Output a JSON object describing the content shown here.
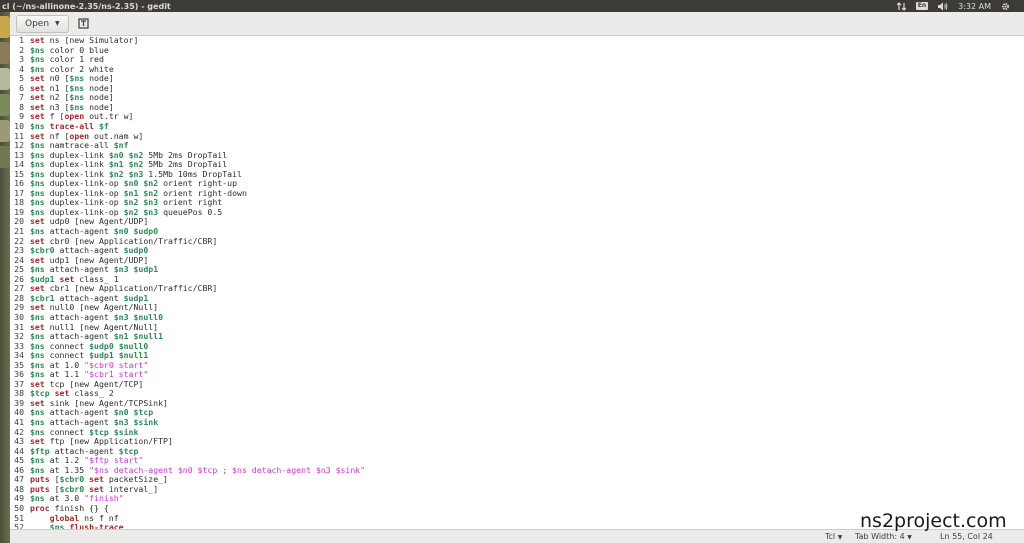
{
  "window": {
    "title": "cl (~/ns-allinone-2.35/ns-2.35) - gedit"
  },
  "tray": {
    "language": "En",
    "time": "3:32 AM"
  },
  "toolbar": {
    "open_label": "Open"
  },
  "statusbar": {
    "language": "Tcl",
    "tab_width": "Tab Width: 4",
    "position": "Ln 55, Col 24"
  },
  "watermark": "ns2project.com",
  "code_lines": [
    [
      [
        "kw",
        "set"
      ],
      [
        "t",
        " ns [new Simulator]"
      ]
    ],
    [
      [
        "var",
        "$ns"
      ],
      [
        "t",
        " color 0 blue"
      ]
    ],
    [
      [
        "var",
        "$ns"
      ],
      [
        "t",
        " color 1 red"
      ]
    ],
    [
      [
        "var",
        "$ns"
      ],
      [
        "t",
        " color 2 white"
      ]
    ],
    [
      [
        "kw",
        "set"
      ],
      [
        "t",
        " n0 ["
      ],
      [
        "var",
        "$ns"
      ],
      [
        "t",
        " node]"
      ]
    ],
    [
      [
        "kw",
        "set"
      ],
      [
        "t",
        " n1 ["
      ],
      [
        "var",
        "$ns"
      ],
      [
        "t",
        " node]"
      ]
    ],
    [
      [
        "kw",
        "set"
      ],
      [
        "t",
        " n2 ["
      ],
      [
        "var",
        "$ns"
      ],
      [
        "t",
        " node]"
      ]
    ],
    [
      [
        "kw",
        "set"
      ],
      [
        "t",
        " n3 ["
      ],
      [
        "var",
        "$ns"
      ],
      [
        "t",
        " node]"
      ]
    ],
    [
      [
        "kw",
        "set"
      ],
      [
        "t",
        " f ["
      ],
      [
        "kw",
        "open"
      ],
      [
        "t",
        " out.tr w]"
      ]
    ],
    [
      [
        "var",
        "$ns"
      ],
      [
        "t",
        " "
      ],
      [
        "kw",
        "trace-all"
      ],
      [
        "t",
        " "
      ],
      [
        "var",
        "$f"
      ]
    ],
    [
      [
        "kw",
        "set"
      ],
      [
        "t",
        " nf ["
      ],
      [
        "kw",
        "open"
      ],
      [
        "t",
        " out.nam w]"
      ]
    ],
    [
      [
        "var",
        "$ns"
      ],
      [
        "t",
        " namtrace-all "
      ],
      [
        "var",
        "$nf"
      ]
    ],
    [
      [
        "var",
        "$ns"
      ],
      [
        "t",
        " duplex-link "
      ],
      [
        "var",
        "$n0"
      ],
      [
        "t",
        " "
      ],
      [
        "var",
        "$n2"
      ],
      [
        "t",
        " 5Mb 2ms DropTail"
      ]
    ],
    [
      [
        "var",
        "$ns"
      ],
      [
        "t",
        " duplex-link "
      ],
      [
        "var",
        "$n1"
      ],
      [
        "t",
        " "
      ],
      [
        "var",
        "$n2"
      ],
      [
        "t",
        " 5Mb 2ms DropTail"
      ]
    ],
    [
      [
        "var",
        "$ns"
      ],
      [
        "t",
        " duplex-link "
      ],
      [
        "var",
        "$n2"
      ],
      [
        "t",
        " "
      ],
      [
        "var",
        "$n3"
      ],
      [
        "t",
        " 1.5Mb 10ms DropTail"
      ]
    ],
    [
      [
        "var",
        "$ns"
      ],
      [
        "t",
        " duplex-link-op "
      ],
      [
        "var",
        "$n0"
      ],
      [
        "t",
        " "
      ],
      [
        "var",
        "$n2"
      ],
      [
        "t",
        " orient right-up"
      ]
    ],
    [
      [
        "var",
        "$ns"
      ],
      [
        "t",
        " duplex-link-op "
      ],
      [
        "var",
        "$n1"
      ],
      [
        "t",
        " "
      ],
      [
        "var",
        "$n2"
      ],
      [
        "t",
        " orient right-down"
      ]
    ],
    [
      [
        "var",
        "$ns"
      ],
      [
        "t",
        " duplex-link-op "
      ],
      [
        "var",
        "$n2"
      ],
      [
        "t",
        " "
      ],
      [
        "var",
        "$n3"
      ],
      [
        "t",
        " orient right"
      ]
    ],
    [
      [
        "var",
        "$ns"
      ],
      [
        "t",
        " duplex-link-op "
      ],
      [
        "var",
        "$n2"
      ],
      [
        "t",
        " "
      ],
      [
        "var",
        "$n3"
      ],
      [
        "t",
        " queuePos 0.5"
      ]
    ],
    [
      [
        "kw",
        "set"
      ],
      [
        "t",
        " udp0 [new Agent/UDP]"
      ]
    ],
    [
      [
        "var",
        "$ns"
      ],
      [
        "t",
        " attach-agent "
      ],
      [
        "var",
        "$n0"
      ],
      [
        "t",
        " "
      ],
      [
        "var",
        "$udp0"
      ]
    ],
    [
      [
        "kw",
        "set"
      ],
      [
        "t",
        " cbr0 [new Application/Traffic/CBR]"
      ]
    ],
    [
      [
        "var",
        "$cbr0"
      ],
      [
        "t",
        " attach-agent "
      ],
      [
        "var",
        "$udp0"
      ]
    ],
    [
      [
        "kw",
        "set"
      ],
      [
        "t",
        " udp1 [new Agent/UDP]"
      ]
    ],
    [
      [
        "var",
        "$ns"
      ],
      [
        "t",
        " attach-agent "
      ],
      [
        "var",
        "$n3"
      ],
      [
        "t",
        " "
      ],
      [
        "var",
        "$udp1"
      ]
    ],
    [
      [
        "var",
        "$udp1"
      ],
      [
        "t",
        " "
      ],
      [
        "kw",
        "set"
      ],
      [
        "t",
        " class_ 1"
      ]
    ],
    [
      [
        "kw",
        "set"
      ],
      [
        "t",
        " cbr1 [new Application/Traffic/CBR]"
      ]
    ],
    [
      [
        "var",
        "$cbr1"
      ],
      [
        "t",
        " attach-agent "
      ],
      [
        "var",
        "$udp1"
      ]
    ],
    [
      [
        "kw",
        "set"
      ],
      [
        "t",
        " null0 [new Agent/Null]"
      ]
    ],
    [
      [
        "var",
        "$ns"
      ],
      [
        "t",
        " attach-agent "
      ],
      [
        "var",
        "$n3"
      ],
      [
        "t",
        " "
      ],
      [
        "var",
        "$null0"
      ]
    ],
    [
      [
        "kw",
        "set"
      ],
      [
        "t",
        " null1 [new Agent/Null]"
      ]
    ],
    [
      [
        "var",
        "$ns"
      ],
      [
        "t",
        " attach-agent "
      ],
      [
        "var",
        "$n1"
      ],
      [
        "t",
        " "
      ],
      [
        "var",
        "$null1"
      ]
    ],
    [
      [
        "var",
        "$ns"
      ],
      [
        "t",
        " connect "
      ],
      [
        "var",
        "$udp0"
      ],
      [
        "t",
        " "
      ],
      [
        "var",
        "$null0"
      ]
    ],
    [
      [
        "var",
        "$ns"
      ],
      [
        "t",
        " connect "
      ],
      [
        "var",
        "$udp1"
      ],
      [
        "t",
        " "
      ],
      [
        "var",
        "$null1"
      ]
    ],
    [
      [
        "var",
        "$ns"
      ],
      [
        "t",
        " at 1.0 "
      ],
      [
        "str",
        "\"$cbr0 start\""
      ]
    ],
    [
      [
        "var",
        "$ns"
      ],
      [
        "t",
        " at 1.1 "
      ],
      [
        "str",
        "\"$cbr1 start\""
      ]
    ],
    [
      [
        "kw",
        "set"
      ],
      [
        "t",
        " tcp [new Agent/TCP]"
      ]
    ],
    [
      [
        "var",
        "$tcp"
      ],
      [
        "t",
        " "
      ],
      [
        "kw",
        "set"
      ],
      [
        "t",
        " class_ 2"
      ]
    ],
    [
      [
        "kw",
        "set"
      ],
      [
        "t",
        " sink [new Agent/TCPSink]"
      ]
    ],
    [
      [
        "var",
        "$ns"
      ],
      [
        "t",
        " attach-agent "
      ],
      [
        "var",
        "$n0"
      ],
      [
        "t",
        " "
      ],
      [
        "var",
        "$tcp"
      ]
    ],
    [
      [
        "var",
        "$ns"
      ],
      [
        "t",
        " attach-agent "
      ],
      [
        "var",
        "$n3"
      ],
      [
        "t",
        " "
      ],
      [
        "var",
        "$sink"
      ]
    ],
    [
      [
        "var",
        "$ns"
      ],
      [
        "t",
        " connect "
      ],
      [
        "var",
        "$tcp"
      ],
      [
        "t",
        " "
      ],
      [
        "var",
        "$sink"
      ]
    ],
    [
      [
        "kw",
        "set"
      ],
      [
        "t",
        " ftp [new Application/FTP]"
      ]
    ],
    [
      [
        "var",
        "$ftp"
      ],
      [
        "t",
        " attach-agent "
      ],
      [
        "var",
        "$tcp"
      ]
    ],
    [
      [
        "var",
        "$ns"
      ],
      [
        "t",
        " at 1.2 "
      ],
      [
        "str",
        "\"$ftp start\""
      ]
    ],
    [
      [
        "var",
        "$ns"
      ],
      [
        "t",
        " at 1.35 "
      ],
      [
        "str",
        "\"$ns detach-agent $n0 $tcp ; $ns detach-agent $n3 $sink\""
      ]
    ],
    [
      [
        "kw",
        "puts"
      ],
      [
        "t",
        " ["
      ],
      [
        "var",
        "$cbr0"
      ],
      [
        "t",
        " "
      ],
      [
        "kw",
        "set"
      ],
      [
        "t",
        " packetSize_]"
      ]
    ],
    [
      [
        "kw",
        "puts"
      ],
      [
        "t",
        " ["
      ],
      [
        "var",
        "$cbr0"
      ],
      [
        "t",
        " "
      ],
      [
        "kw",
        "set"
      ],
      [
        "t",
        " interval_]"
      ]
    ],
    [
      [
        "var",
        "$ns"
      ],
      [
        "t",
        " at 3.0 "
      ],
      [
        "str",
        "\"finish\""
      ]
    ],
    [
      [
        "kw",
        "proc"
      ],
      [
        "t",
        " finish {} {"
      ]
    ],
    [
      [
        "t",
        "    "
      ],
      [
        "kw",
        "global"
      ],
      [
        "t",
        " ns f nf"
      ]
    ],
    [
      [
        "t",
        "    "
      ],
      [
        "var",
        "$ns"
      ],
      [
        "t",
        " "
      ],
      [
        "kw",
        "flush-trace"
      ]
    ]
  ],
  "colors": {
    "keyword": "#a52a2a",
    "variable": "#2e8b57",
    "string": "#d633d6"
  }
}
